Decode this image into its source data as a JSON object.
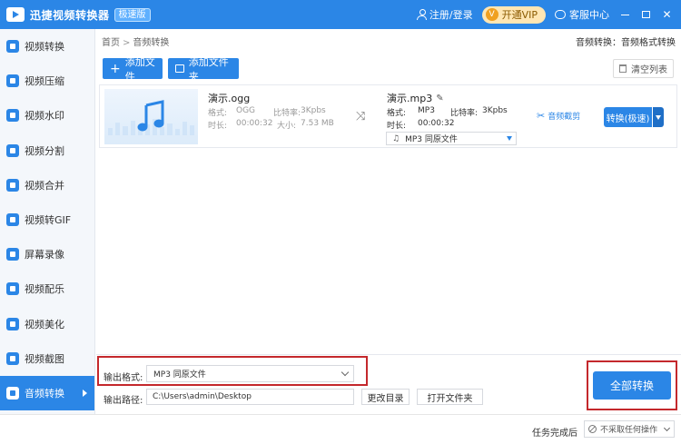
{
  "app": {
    "title": "迅捷视频转换器",
    "badge": "极速版",
    "login": "注册/登录",
    "vip": "开通VIP",
    "vip_icon": "V",
    "service": "客服中心",
    "minimize_icon": "—",
    "close_icon": "✕"
  },
  "sidebar": {
    "items": [
      {
        "label": "视频转换",
        "icon": "video-convert-icon"
      },
      {
        "label": "视频压缩",
        "icon": "video-compress-icon"
      },
      {
        "label": "视频水印",
        "icon": "video-watermark-icon"
      },
      {
        "label": "视频分割",
        "icon": "video-split-icon"
      },
      {
        "label": "视频合并",
        "icon": "video-merge-icon"
      },
      {
        "label": "视频转GIF",
        "icon": "video-gif-icon"
      },
      {
        "label": "屏幕录像",
        "icon": "screen-record-icon"
      },
      {
        "label": "视频配乐",
        "icon": "video-music-icon"
      },
      {
        "label": "视频美化",
        "icon": "video-beautify-icon"
      },
      {
        "label": "视频截图",
        "icon": "video-screenshot-icon"
      },
      {
        "label": "音频转换",
        "icon": "audio-convert-icon",
        "active": true
      }
    ]
  },
  "breadcrumb": {
    "home": "首页",
    "sep": ">",
    "current": "音频转换"
  },
  "top_format_label": "音频转换：音频格式转换",
  "toolbar": {
    "add_file": "添加文件",
    "add_folder": "添加文件夹",
    "clear_list": "清空列表"
  },
  "file": {
    "source": {
      "name": "演示.ogg",
      "format_label": "格式:",
      "format": "OGG",
      "bitrate_label": "比特率:",
      "bitrate": "3Kpbs",
      "duration_label": "时长:",
      "duration": "00:00:32",
      "size_label": "大小:",
      "size": "7.53 MB"
    },
    "target": {
      "name": "演示.mp3",
      "format_label": "格式:",
      "format": "MP3",
      "bitrate_label": "比特率:",
      "bitrate": "3Kpbs",
      "duration_label": "时长:",
      "duration": "00:00:32",
      "select_value": "MP3   同原文件"
    },
    "audio_cut": "音频截剪",
    "convert": "转换(极速)"
  },
  "output": {
    "format_label": "输出格式:",
    "format_value": "MP3   同原文件",
    "path_label": "输出路径:",
    "path_value": "C:\\Users\\admin\\Desktop",
    "change_dir": "更改目录",
    "open_folder": "打开文件夹",
    "convert_all": "全部转换"
  },
  "status": {
    "after_label": "任务完成后",
    "after_value": "不采取任何操作"
  },
  "colors": {
    "accent": "#2b86e6",
    "highlight": "#c4282c"
  }
}
